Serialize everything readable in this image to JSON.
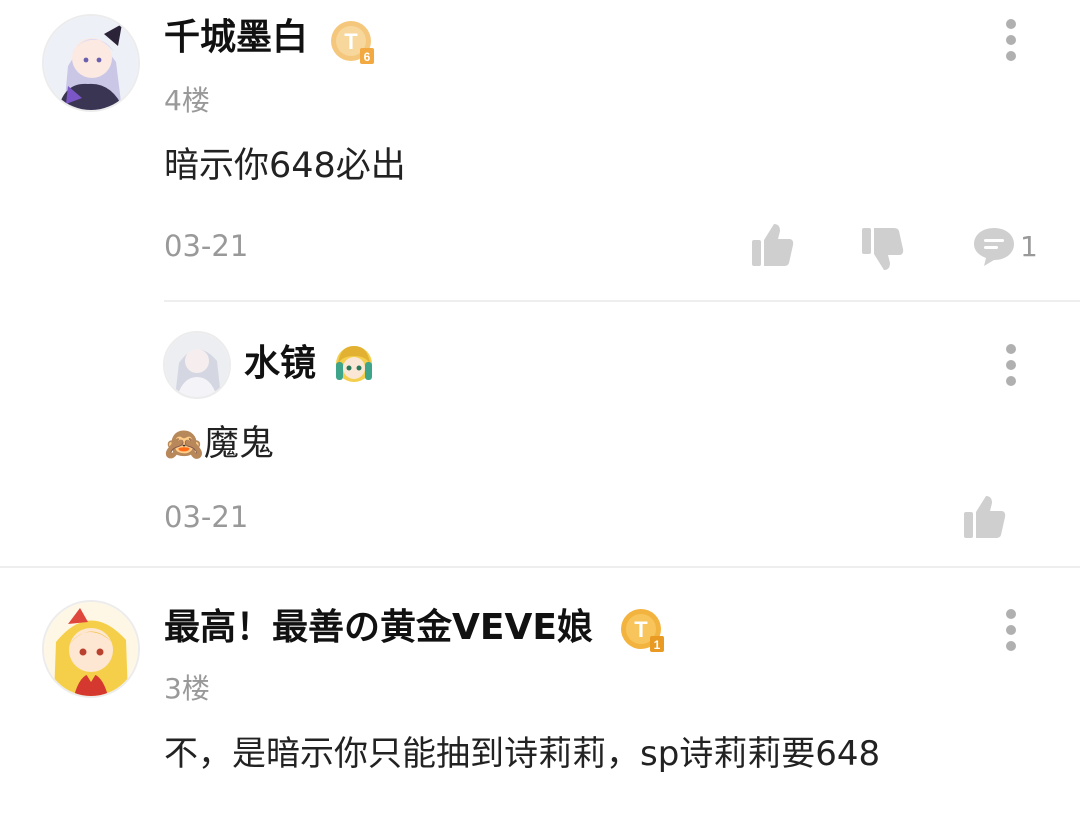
{
  "comments": [
    {
      "username": "千城墨白",
      "badge": "T6",
      "floor": "4楼",
      "content": "暗示你648必出",
      "date": "03-21",
      "reply_count": "1",
      "reply": {
        "username": "水镜",
        "content": "魔鬼",
        "emoji": "🙈",
        "date": "03-21"
      }
    },
    {
      "username": "最高！最善の黄金VEVE娘",
      "badge": "T1",
      "floor": "3楼",
      "content": "不，是暗示你只能抽到诗莉莉，sp诗莉莉要648"
    }
  ],
  "colors": {
    "text_primary": "#111111",
    "text_secondary": "#999999",
    "icon_gray": "#cfcfcf",
    "badge_gold": "#f0b44a",
    "divider": "#eeeeee"
  },
  "icons": {
    "more": "more-vertical-icon",
    "like": "thumbs-up-icon",
    "dislike": "thumbs-down-icon",
    "reply": "comment-bubble-icon"
  }
}
